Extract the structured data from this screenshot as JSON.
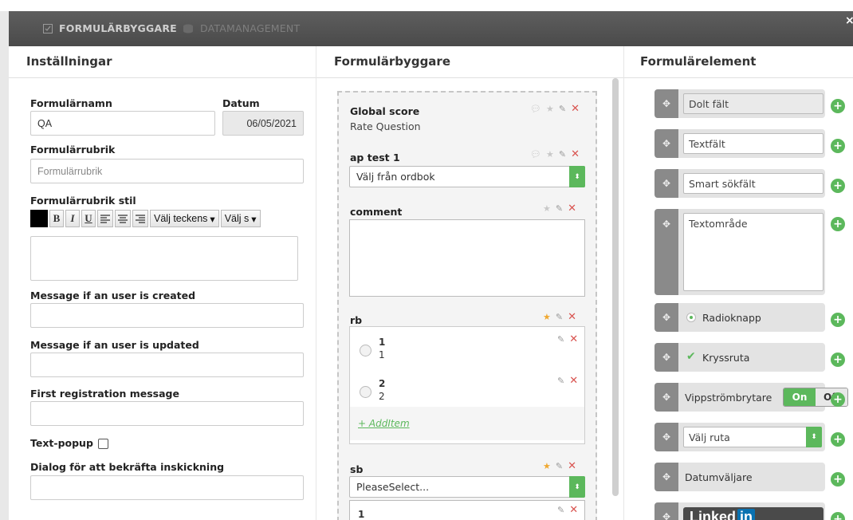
{
  "tabs": [
    {
      "label": "FORMULÄRBYGGARE",
      "icon": "form-icon"
    },
    {
      "label": "DATAMANAGEMENT",
      "icon": "database-icon"
    }
  ],
  "close_label": "×",
  "settings": {
    "heading": "Inställningar",
    "form_name_label": "Formulärnamn",
    "form_name_value": "QA",
    "date_label": "Datum",
    "date_value": "06/05/2021",
    "form_title_label": "Formulärrubrik",
    "form_title_placeholder": "Formulärrubrik",
    "form_title_style_label": "Formulärrubrik stil",
    "toolbar": {
      "bold": "B",
      "italic": "I",
      "underline": "U",
      "font_select": "Välj teckens",
      "size_select": "Välj s"
    },
    "msg_created_label": "Message if an user is created",
    "msg_updated_label": "Message if an user is updated",
    "first_reg_label": "First registration message",
    "text_popup_label": "Text-popup",
    "confirm_dialog_label": "Dialog för att bekräfta inskickning"
  },
  "builder": {
    "heading": "Formulärbyggare",
    "items": [
      {
        "title": "Global score",
        "subtitle": "Rate Question"
      },
      {
        "title": "ap test 1",
        "select_value": "Välj från ordbok"
      },
      {
        "title": "comment"
      },
      {
        "title": "rb",
        "options": [
          {
            "title": "1",
            "value": "1"
          },
          {
            "title": "2",
            "value": "2"
          }
        ],
        "add_item": "+ AddItem"
      },
      {
        "title": "sb",
        "select_value": "PleaseSelect...",
        "first_option": "1"
      }
    ]
  },
  "elements": {
    "heading": "Formulärelement",
    "hidden": "Dolt fält",
    "text": "Textfält",
    "smart_search": "Smart sökfält",
    "textarea": "Textområde",
    "radio": "Radioknapp",
    "checkbox": "Kryssruta",
    "toggle": "Vippströmbrytare",
    "toggle_on": "On",
    "toggle_off": "Off",
    "select": "Välj ruta",
    "datepicker": "Datumväljare",
    "linkedin_text": "Linked",
    "linkedin_in": "in"
  },
  "colors": {
    "accent_green": "#5cb85c",
    "delete_red": "#d9534f",
    "star_orange": "#f0a830",
    "titlebar": "#555555"
  }
}
